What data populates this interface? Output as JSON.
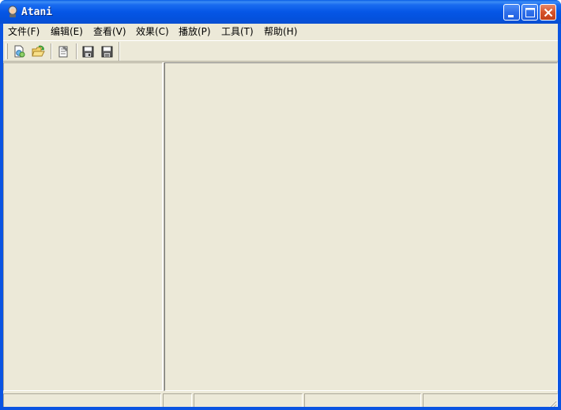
{
  "window": {
    "title": "Atani",
    "minimize_icon": "minimize-icon",
    "maximize_icon": "maximize-icon",
    "close_icon": "close-icon"
  },
  "menu": {
    "items": [
      {
        "label": "文件(F)"
      },
      {
        "label": "编辑(E)"
      },
      {
        "label": "查看(V)"
      },
      {
        "label": "效果(C)"
      },
      {
        "label": "播放(P)"
      },
      {
        "label": "工具(T)"
      },
      {
        "label": "帮助(H)"
      }
    ]
  },
  "toolbar": {
    "buttons": [
      {
        "icon": "new-file-icon"
      },
      {
        "icon": "open-folder-icon"
      },
      {
        "icon": "properties-icon"
      },
      {
        "icon": "save-icon"
      },
      {
        "icon": "save-as-icon"
      }
    ]
  },
  "statusbar": {
    "panels": [
      "",
      "",
      "",
      "",
      ""
    ]
  },
  "colors": {
    "titlebar": "#0a54e2",
    "face": "#ece9d8",
    "shadow": "#aca899",
    "close_button": "#d6522a"
  }
}
